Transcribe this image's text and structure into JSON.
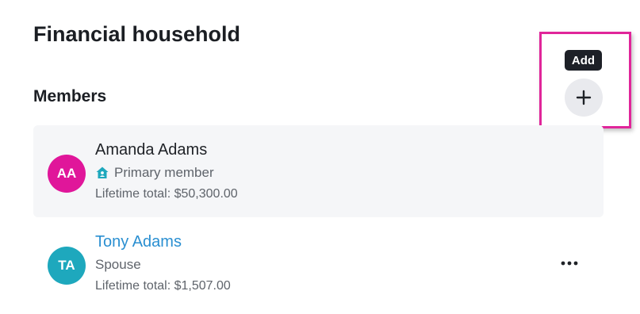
{
  "page": {
    "title": "Financial household"
  },
  "members_section": {
    "heading": "Members",
    "add_tooltip": "Add",
    "add_icon": "plus-icon"
  },
  "members": [
    {
      "initials": "AA",
      "avatar_color": "#e0169a",
      "name": "Amanda Adams",
      "role_icon": "house-icon",
      "role": "Primary member",
      "lifetime_total": "Lifetime total: $50,300.00"
    },
    {
      "initials": "TA",
      "avatar_color": "#1ea8bd",
      "name": "Tony Adams",
      "role": "Spouse",
      "lifetime_total": "Lifetime total: $1,507.00",
      "menu_icon": "more-horizontal-icon"
    }
  ],
  "colors": {
    "highlight": "#e0259a",
    "link": "#2a8fd1",
    "tooltip_bg": "#1d2027",
    "role_icon": "#1ea8bd"
  }
}
